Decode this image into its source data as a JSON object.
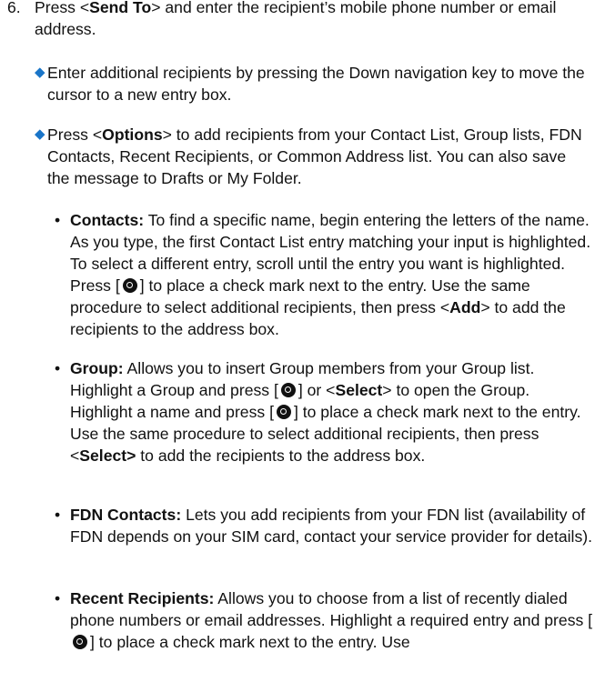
{
  "step6": {
    "number": "6.",
    "t1": "Press <",
    "b1": "Send To",
    "t2": "> and enter the recipient’s mobile phone number or email address."
  },
  "diamond1": {
    "text": "Enter additional recipients by pressing the Down navigation key to move the cursor to a new entry box."
  },
  "diamond2": {
    "t1": "Press <",
    "b1": "Options",
    "t2": "> to add recipients from your Contact List, Group lists, FDN Contacts, Recent Recipients, or Common Address list. You can also save the message to Drafts or My Folder."
  },
  "contacts": {
    "label": "Contacts:",
    "t1": " To find a specific name, begin entering the letters of the name. As you type, the first Contact List entry matching your input is highlighted. To select a different entry, scroll until the entry you want is highlighted. Press [",
    "t2": "] to place a check mark next to the entry. Use the same procedure to select additional recipients, then press <",
    "b1": "Add",
    "t3": "> to add the recipients to the address box."
  },
  "group": {
    "label": "Group:",
    "t1": " Allows you to insert Group members from your Group list. Highlight a Group and press [",
    "t2": "] or <",
    "b1": "Select",
    "t3": "> to open the Group. Highlight a name and press [",
    "t4": "] to place a check mark next to the entry. Use the same procedure to select additional recipients, then press <",
    "b2": "Select>",
    "t5": " to add the recipients to the address box."
  },
  "fdn": {
    "label": "FDN Contacts:",
    "t1": " Lets you add recipients from your FDN list (availability of FDN depends on your SIM card, contact your service provider for details)."
  },
  "recent": {
    "label": "Recent Recipients:",
    "t1": " Allows you to choose from a list of recently dialed phone numbers or email addresses. Highlight a required entry and press [",
    "t2": "] to place a check mark next to the entry. Use"
  },
  "glyphs": {
    "diamond": "◆",
    "bullet": "•"
  },
  "icons": {
    "select_key": "navigation-select-key-icon"
  },
  "colors": {
    "diamond": "#1a75c8",
    "text": "#111111"
  }
}
